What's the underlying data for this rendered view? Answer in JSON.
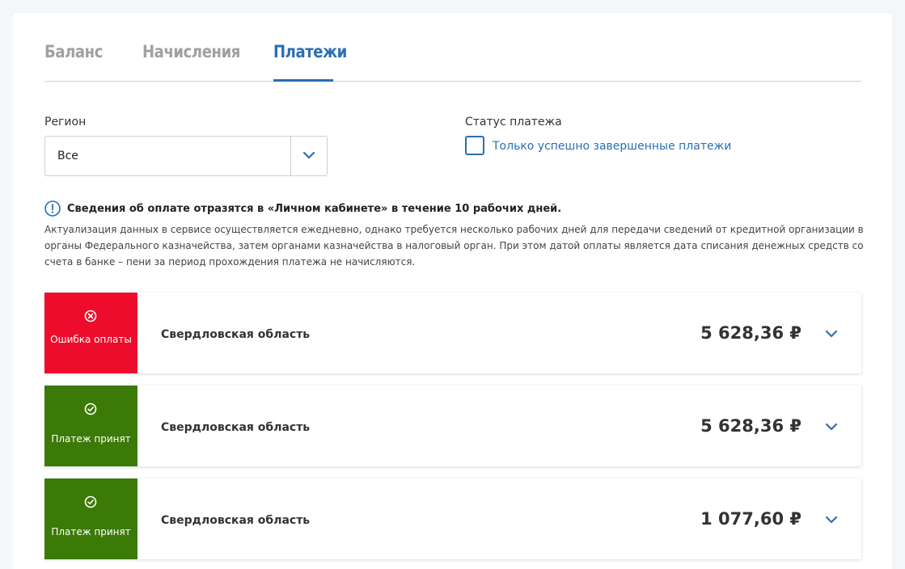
{
  "tabs": [
    {
      "label": "Баланс",
      "active": false
    },
    {
      "label": "Начисления",
      "active": false
    },
    {
      "label": "Платежи",
      "active": true
    }
  ],
  "filters": {
    "region_label": "Регион",
    "region_value": "Все",
    "status_label": "Статус платежа",
    "only_success_label": "Только успешно завершенные платежи",
    "only_success_checked": false
  },
  "info": {
    "title": "Сведения об оплате отразятся в «Личном кабинете» в течение 10 рабочих дней.",
    "text": "Актуализация данных в сервисе осуществляется ежедневно, однако требуется несколько рабочих дней для передачи сведений от кредитной организации в органы Федерального казначейства, затем органами казначейства в налоговый орган. При этом датой оплаты является дата списания денежных средств со счета в банке – пени за период прохождения платежа не начисляются."
  },
  "payments": [
    {
      "status": "Ошибка оплаты",
      "status_icon": "error-circle-icon",
      "status_color": "#ee0c2c",
      "region": "Свердловская область",
      "amount": "5 628,36 ₽"
    },
    {
      "status": "Платеж принят",
      "status_icon": "check-circle-icon",
      "status_color": "#3c7a08",
      "region": "Свердловская область",
      "amount": "5 628,36 ₽"
    },
    {
      "status": "Платеж принят",
      "status_icon": "check-circle-icon",
      "status_color": "#3c7a08",
      "region": "Свердловская область",
      "amount": "1 077,60 ₽"
    }
  ],
  "colors": {
    "accent": "#2a6fb3",
    "error": "#ee0c2c",
    "success": "#3c7a08"
  }
}
